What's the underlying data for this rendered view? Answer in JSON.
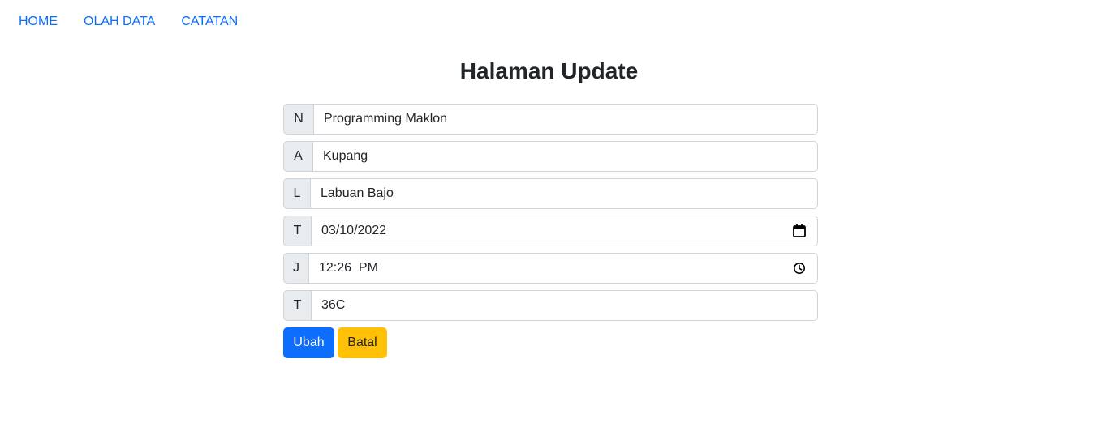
{
  "nav": {
    "items": [
      "HOME",
      "OLAH DATA",
      "CATATAN"
    ]
  },
  "page": {
    "title": "Halaman Update"
  },
  "form": {
    "fields": [
      {
        "label": "N",
        "value": "Programming Maklon"
      },
      {
        "label": "A",
        "value": "Kupang"
      },
      {
        "label": "L",
        "value": "Labuan Bajo"
      },
      {
        "label": "T",
        "value": "03/10/2022",
        "icon": "calendar-icon"
      },
      {
        "label": "J",
        "value": "12:26  PM",
        "icon": "clock-icon"
      },
      {
        "label": "T",
        "value": "36C"
      }
    ],
    "submit_label": "Ubah",
    "cancel_label": "Batal"
  },
  "colors": {
    "primary": "#0d6efd",
    "warning": "#ffc107",
    "addon_bg": "#e9ecef"
  }
}
